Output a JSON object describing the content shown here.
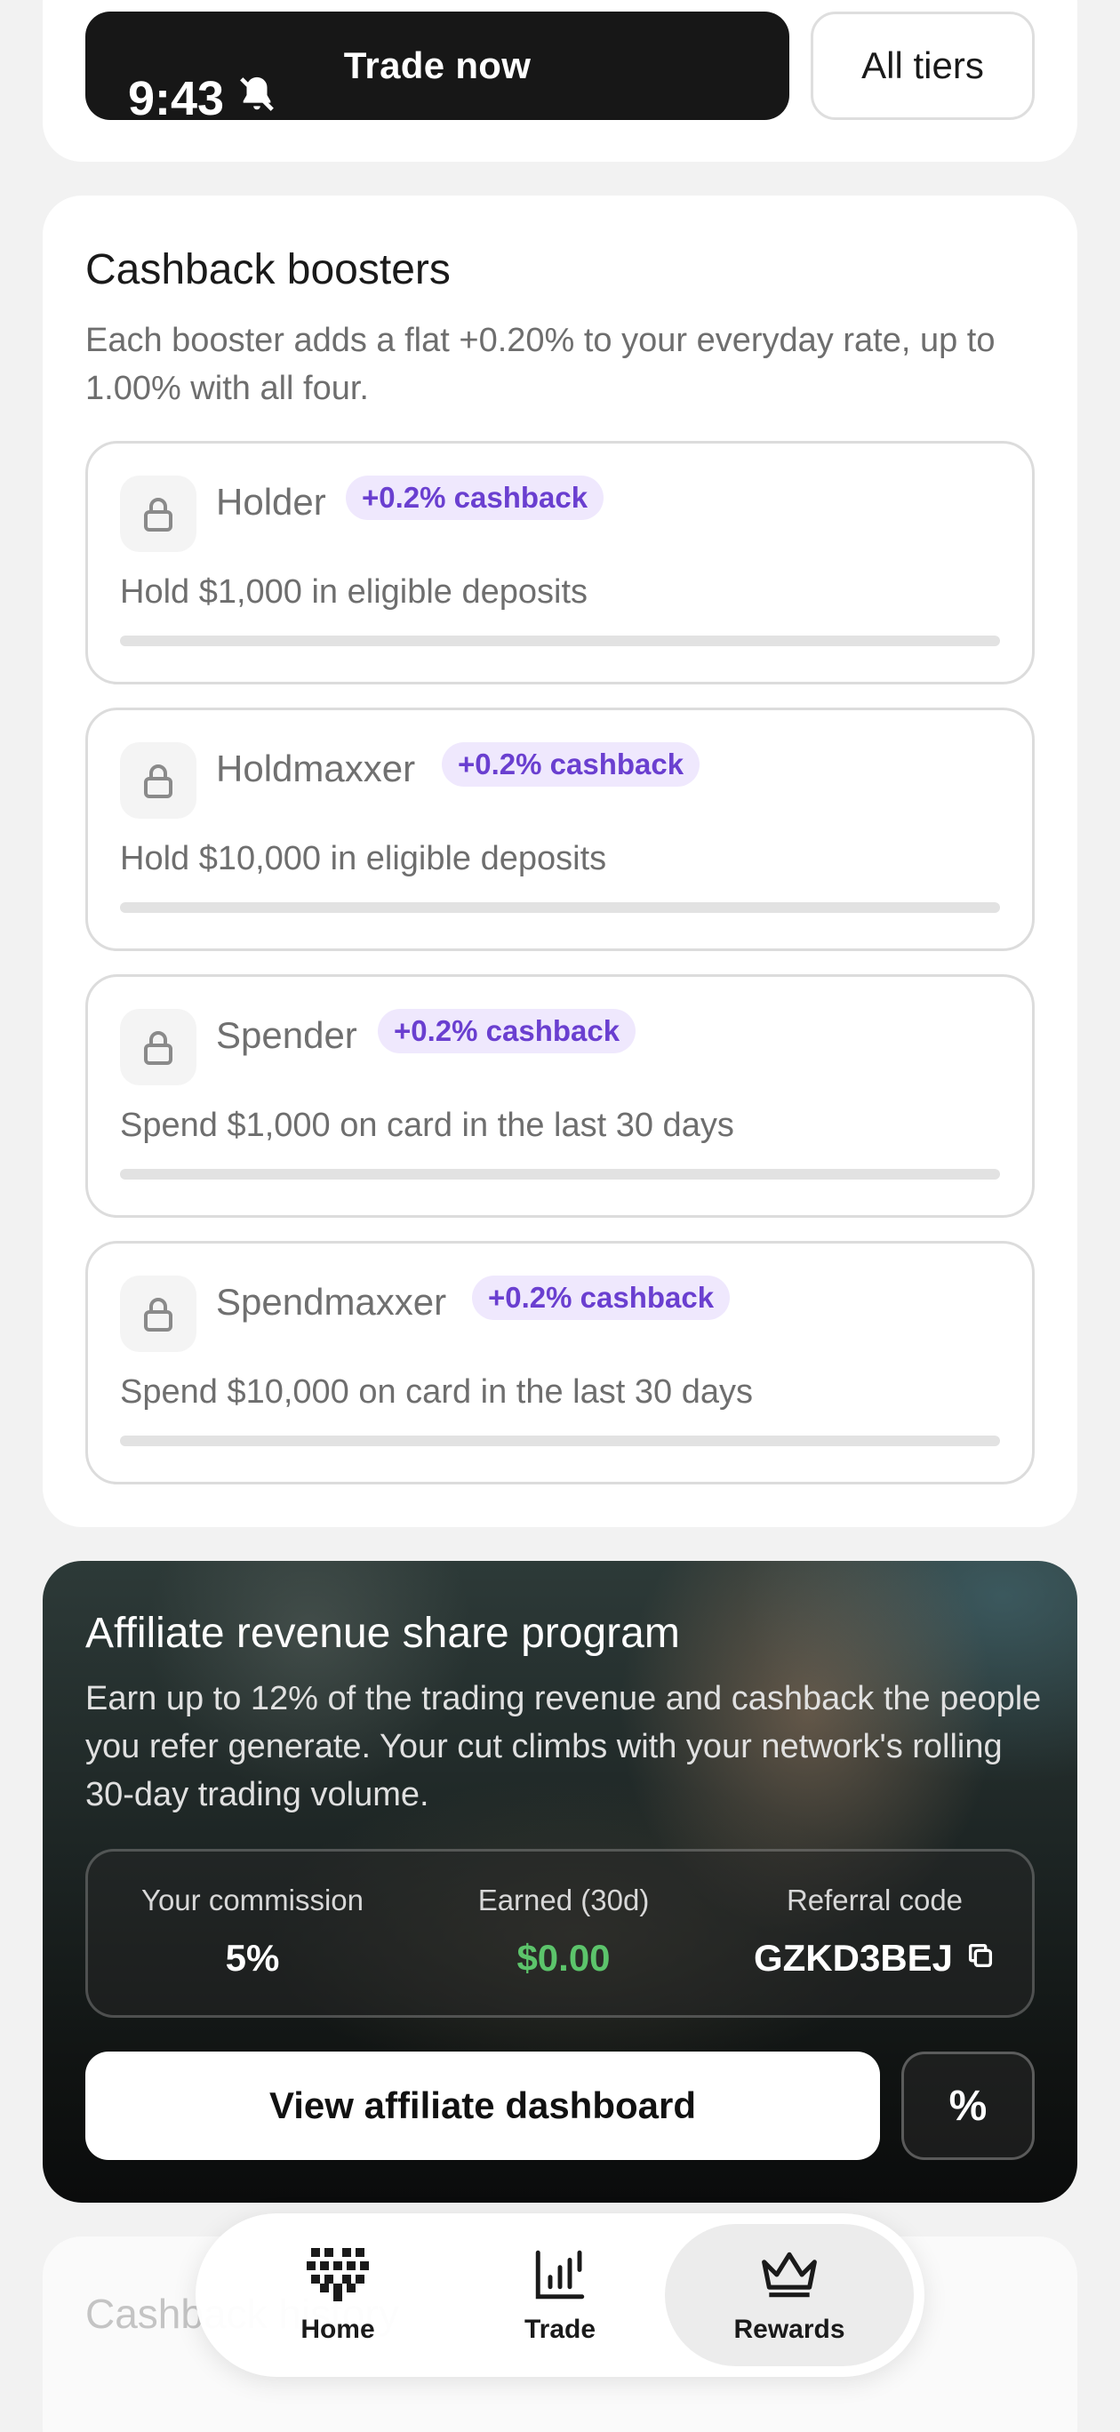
{
  "status_bar": {
    "time": "9:43"
  },
  "top_card": {
    "trade_now_label": "Trade now",
    "all_tiers_label": "All tiers"
  },
  "boosters": {
    "title": "Cashback boosters",
    "description": "Each booster adds a flat +0.20% to your everyday rate, up to 1.00% with all four.",
    "items": [
      {
        "name": "Holder",
        "badge": "+0.2% cashback",
        "requirement": "Hold $1,000 in eligible deposits",
        "progress": 0
      },
      {
        "name": "Holdmaxxer",
        "badge": "+0.2% cashback",
        "requirement": "Hold $10,000 in eligible deposits",
        "progress": 0
      },
      {
        "name": "Spender",
        "badge": "+0.2% cashback",
        "requirement": "Spend $1,000 on card in the last 30 days",
        "progress": 0
      },
      {
        "name": "Spendmaxxer",
        "badge": "+0.2% cashback",
        "requirement": "Spend $10,000 on card in the last 30 days",
        "progress": 0
      }
    ]
  },
  "affiliate": {
    "title": "Affiliate revenue share program",
    "description": "Earn up to 12% of the trading revenue and cashback the people you refer generate. Your cut climbs with your network's rolling 30-day trading volume.",
    "commission_label": "Your commission",
    "commission_value": "5%",
    "earned_label": "Earned (30d)",
    "earned_value": "$0.00",
    "referral_label": "Referral code",
    "referral_code": "GZKD3BEJ",
    "dashboard_button": "View affiliate dashboard",
    "percent_button": "%"
  },
  "history": {
    "title": "Cashback history"
  },
  "tabbar": {
    "items": [
      {
        "label": "Home",
        "icon": "heart-pixel-icon"
      },
      {
        "label": "Trade",
        "icon": "chart-icon"
      },
      {
        "label": "Rewards",
        "icon": "crown-icon"
      }
    ],
    "active": "Rewards"
  },
  "colors": {
    "accent": "#6a3fd0",
    "badge_bg": "#efe8fd",
    "earned_green": "#5cc46b"
  }
}
